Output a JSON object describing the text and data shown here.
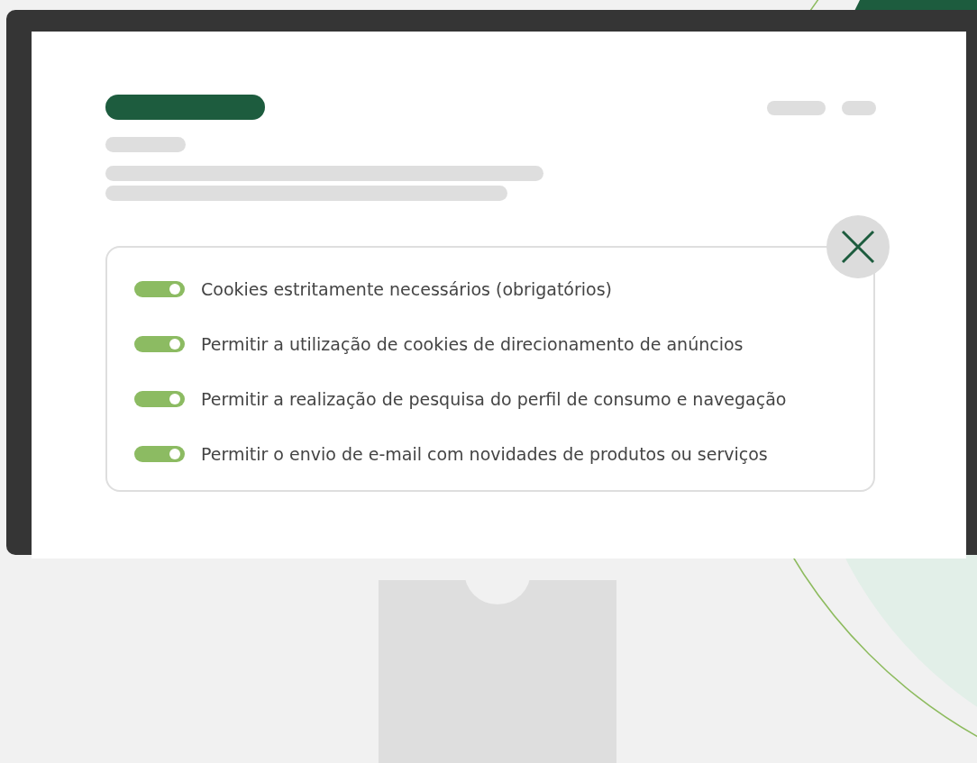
{
  "toggles": [
    {
      "label": "Cookies estritamente necessários (obrigatórios)",
      "on": true
    },
    {
      "label": "Permitir a utilização de cookies de direcionamento de anúncios",
      "on": true
    },
    {
      "label": "Permitir a realização de pesquisa do perfil de consumo e navegação",
      "on": true
    },
    {
      "label": "Permitir o envio de e-mail com novidades de produtos ou serviços",
      "on": true
    }
  ]
}
